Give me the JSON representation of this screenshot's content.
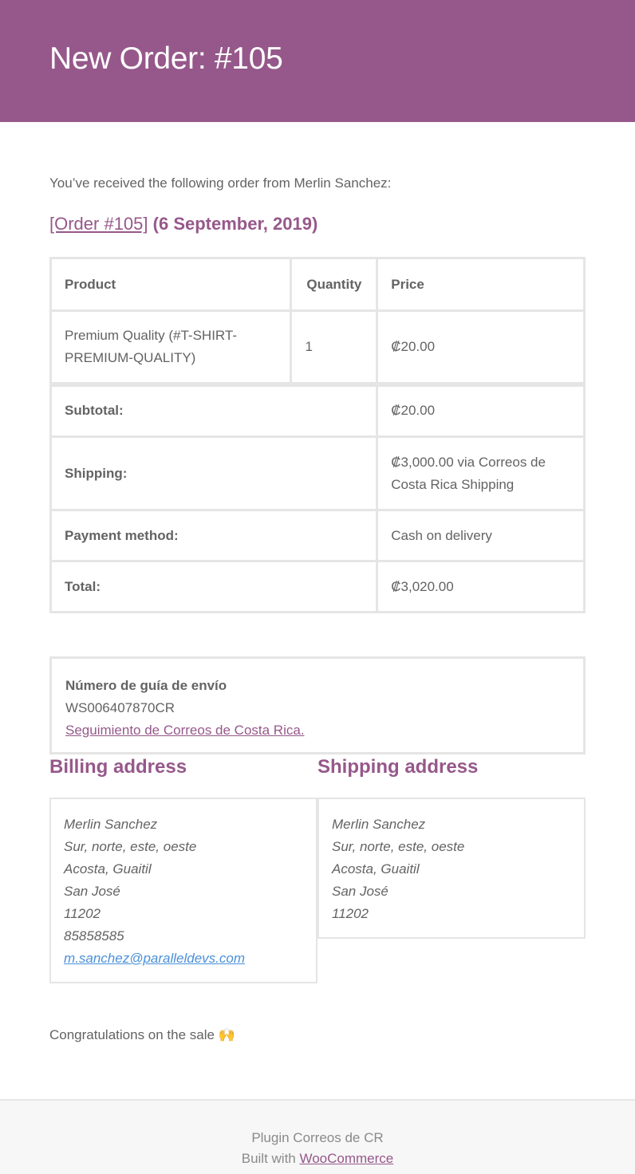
{
  "header": {
    "title": "New Order: #105"
  },
  "intro": "You’ve received the following order from Merlin Sanchez:",
  "order_heading": {
    "link_text": "[Order #105]",
    "date": "(6 September, 2019)"
  },
  "table": {
    "headers": {
      "product": "Product",
      "quantity": "Quantity",
      "price": "Price"
    },
    "item": {
      "product": "Premium Quality (#T-SHIRT-PREMIUM-QUALITY)",
      "quantity": "1",
      "price": "₡20.00"
    },
    "totals": [
      {
        "label": "Subtotal:",
        "value": "₡20.00"
      },
      {
        "label": "Shipping:",
        "value": "₡3,000.00 via Correos de Costa Rica Shipping"
      },
      {
        "label": "Payment method:",
        "value": "Cash on delivery"
      },
      {
        "label": "Total:",
        "value": "₡3,020.00"
      }
    ]
  },
  "tracking": {
    "title": "Número de guía de envío",
    "number": "WS006407870CR",
    "link_text": "Seguimiento de Correos de Costa Rica."
  },
  "billing": {
    "title": "Billing address",
    "name": "Merlin Sanchez",
    "street": "Sur, norte, este, oeste",
    "city": "Acosta, Guaitil",
    "state": "San José",
    "postcode": "11202",
    "phone": "85858585",
    "email": "m.sanchez@paralleldevs.com"
  },
  "shipping": {
    "title": "Shipping address",
    "name": "Merlin Sanchez",
    "street": "Sur, norte, este, oeste",
    "city": "Acosta, Guaitil",
    "state": "San José",
    "postcode": "11202"
  },
  "congrats": "Congratulations on the sale 🙌",
  "footer": {
    "line1": "Plugin Correos de CR",
    "line2_prefix": "Built with ",
    "link_text": "WooCommerce"
  },
  "colors": {
    "brand": "#96588a",
    "text": "#636363",
    "border": "#e5e5e5",
    "email_link": "#4a90d9"
  }
}
